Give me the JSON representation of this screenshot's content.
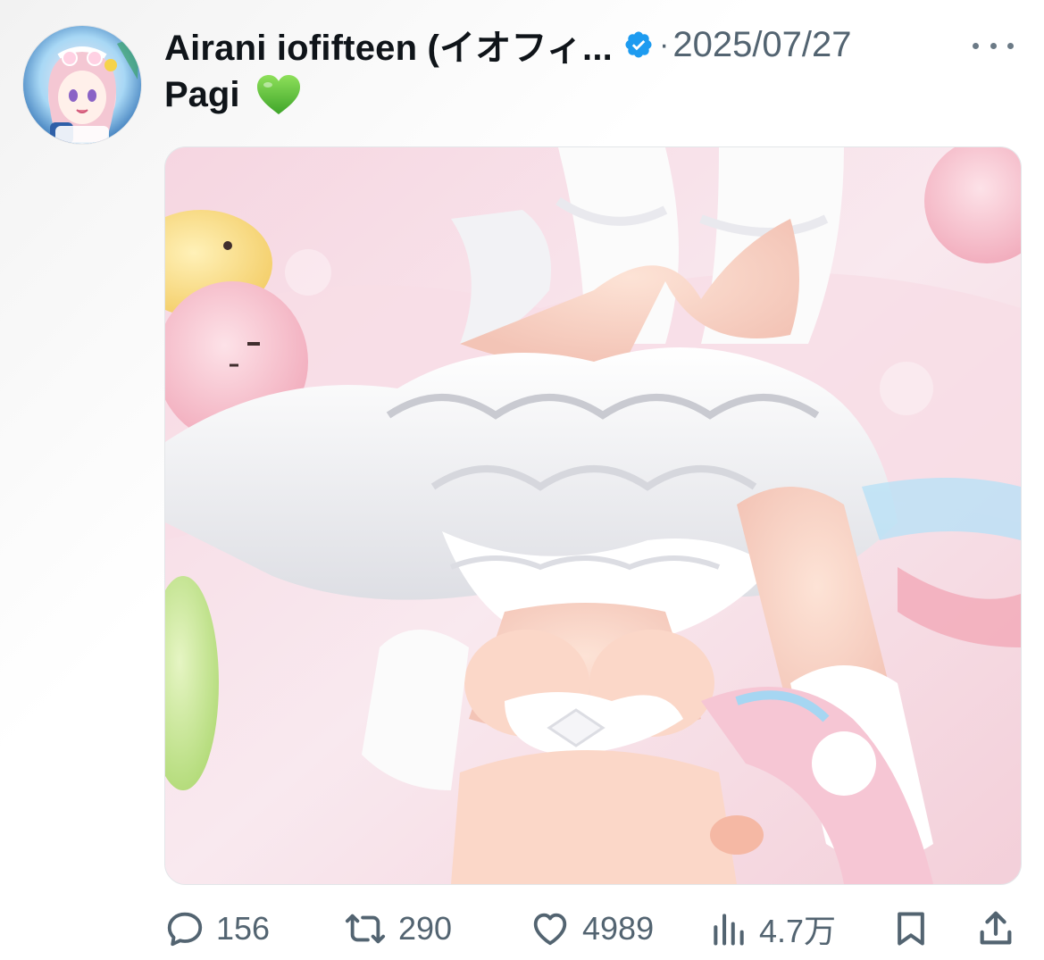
{
  "post": {
    "author": {
      "display_name": "Airani iofifteen (イオフィ...",
      "verified_icon": "verified-badge-icon"
    },
    "separator": "·",
    "date": "2025/07/27",
    "more_icon": "more-horizontal-icon",
    "text": "Pagi",
    "text_emoji": "green-heart-icon",
    "media_alt": "anime illustration"
  },
  "actions": {
    "reply": {
      "icon": "reply-icon",
      "count": "156"
    },
    "retweet": {
      "icon": "retweet-icon",
      "count": "290"
    },
    "like": {
      "icon": "heart-icon",
      "count": "4989"
    },
    "views": {
      "icon": "views-bar-chart-icon",
      "count": "4.7万"
    },
    "bookmark": {
      "icon": "bookmark-icon"
    },
    "share": {
      "icon": "share-icon"
    }
  },
  "colors": {
    "text_primary": "#0f1419",
    "text_secondary": "#536471",
    "verified_blue": "#1d9bf0",
    "heart_green": "#5bc236"
  }
}
